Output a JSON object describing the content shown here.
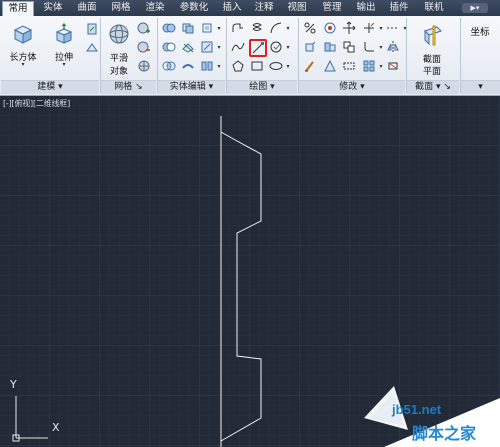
{
  "tabs": [
    "常用",
    "实体",
    "曲面",
    "网格",
    "渲染",
    "参数化",
    "插入",
    "注释",
    "视图",
    "管理",
    "输出",
    "插件",
    "联机"
  ],
  "ribbon": {
    "modeling": {
      "box_label": "长方体",
      "extrude_label": "拉伸",
      "title": "建模"
    },
    "mesh": {
      "smooth_label": "平滑",
      "smooth_label2": "对象",
      "title": "网格"
    },
    "solid_edit": {
      "title": "实体编辑"
    },
    "draw": {
      "title": "绘图"
    },
    "modify": {
      "title": "修改"
    },
    "section": {
      "plane_label": "截面",
      "plane_label2": "平面",
      "title": "截面"
    },
    "coords": {
      "title": "坐标"
    }
  },
  "viewport": {
    "label": "[-][俯视][二维线框]"
  },
  "ucs": {
    "x": "X",
    "y": "Y"
  },
  "watermark": {
    "url": "jb51.net",
    "name": "脚本之家"
  },
  "colors": {
    "canvas": "#212a36",
    "grid": "#2d3745",
    "highlight": "#e02020"
  }
}
